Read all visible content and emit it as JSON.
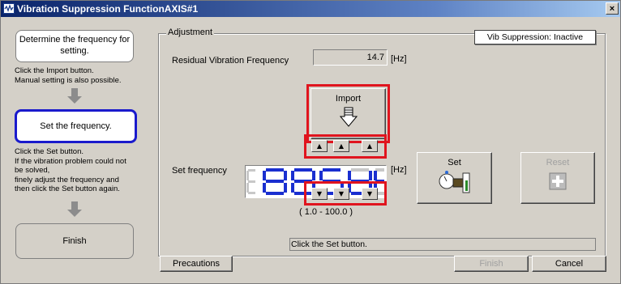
{
  "window": {
    "title": "Vibration Suppression FunctionAXIS#1",
    "close_label": "×"
  },
  "steps": {
    "step1_label": "Determine the frequency for setting.",
    "step1_note_lines": [
      "Click the Import button.",
      "Manual setting is also possible."
    ],
    "step2_label": "Set the frequency.",
    "step2_note_lines": [
      "Click the Set button.",
      "If the vibration problem could not",
      "be solved,",
      "finely adjust the frequency and",
      "then click the Set button again."
    ],
    "step3_label": "Finish"
  },
  "adjustment": {
    "group_label": "Adjustment",
    "status": "Vib Suppression: Inactive",
    "residual_label": "Residual Vibration Frequency",
    "residual_value": "14.7",
    "residual_unit": "[Hz]",
    "import_label": "Import",
    "set_freq_label": "Set frequency",
    "set_freq_unit": "[Hz]",
    "range_text": "(   1.0 - 100.0 )",
    "set_label": "Set",
    "reset_label": "Reset",
    "message": "Click the Set button."
  },
  "footer": {
    "precautions_label": "Precautions",
    "finish_label": "Finish",
    "cancel_label": "Cancel"
  },
  "colors": {
    "titlebar": "#0a246a",
    "highlight": "#e0141e",
    "active_step_border": "#1a1acc",
    "lcd_segment": "#1a2fd0"
  }
}
